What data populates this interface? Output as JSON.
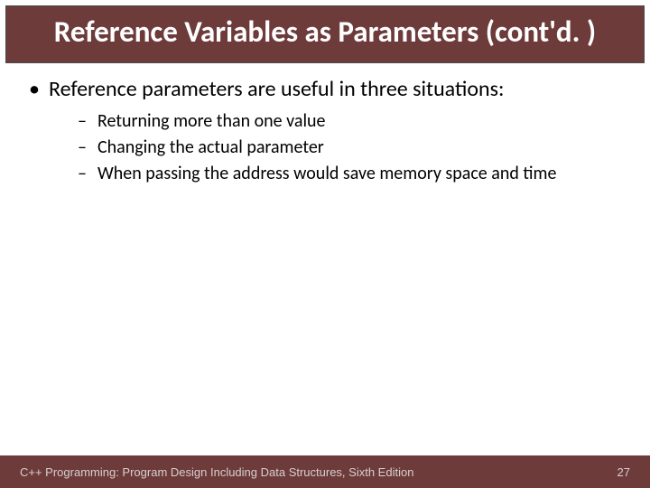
{
  "title": "Reference Variables as Parameters (cont'd. )",
  "bullets": {
    "main": "Reference parameters are useful in three situations:",
    "sub": [
      "Returning more than one value",
      "Changing the actual parameter",
      "When passing the address would save memory space and time"
    ]
  },
  "footer": {
    "text": "C++ Programming: Program Design Including Data Structures, Sixth Edition",
    "page": "27"
  },
  "marks": {
    "l1": "•",
    "l2": "–"
  }
}
